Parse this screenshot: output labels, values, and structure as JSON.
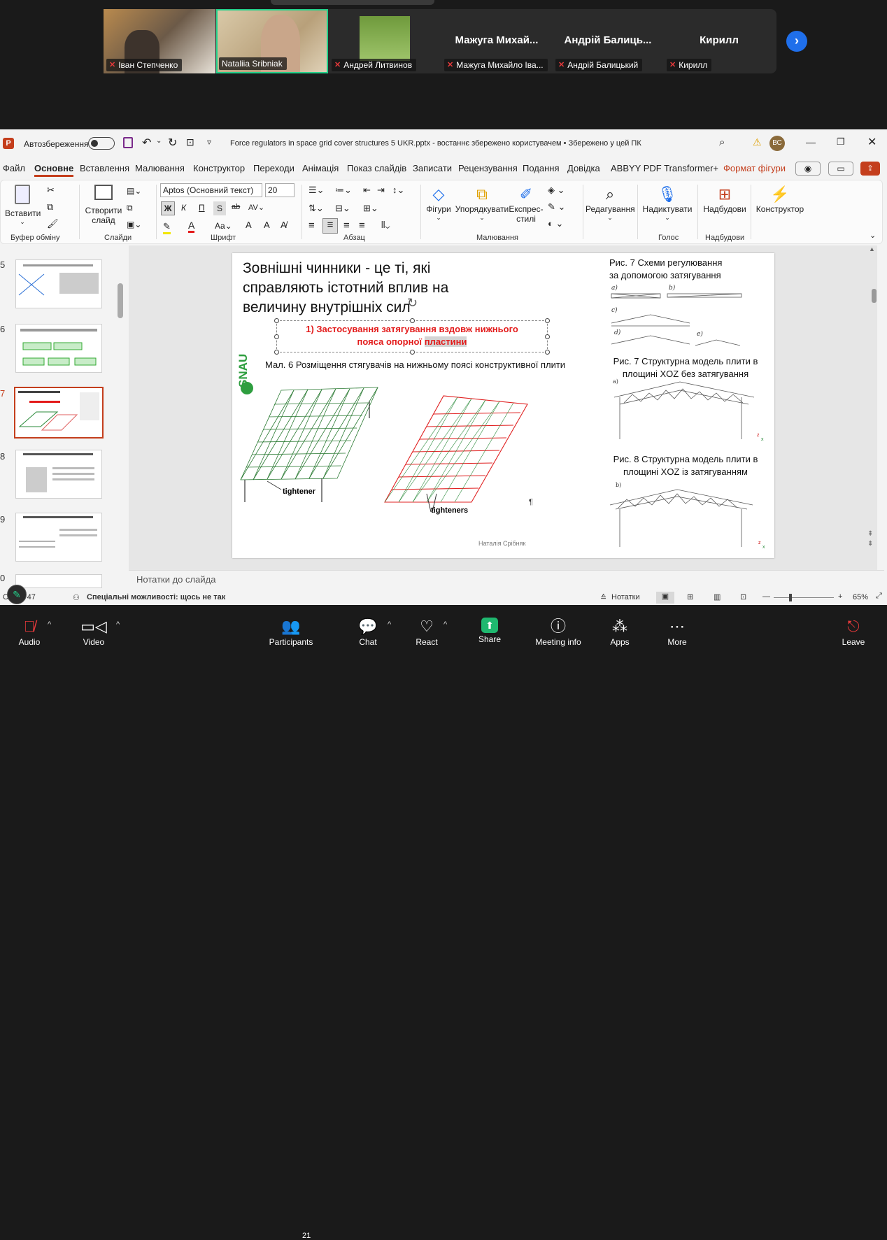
{
  "meeting": {
    "participants": [
      {
        "name": "Іван Степченко",
        "video": true
      },
      {
        "name": "Nataliia Sribniak",
        "video": true
      },
      {
        "name": "Андрей Литвинов",
        "video": true
      },
      {
        "name": "Мажуга Михайло Іва...",
        "display": "Мажуга  Михай..."
      },
      {
        "name": "Андрій Балицький",
        "display": "Андрій  Балиць..."
      },
      {
        "name": "Кирилл",
        "display": "Кирилл"
      }
    ],
    "toolbar": {
      "audio": "Audio",
      "video": "Video",
      "participants": "Participants",
      "participants_count": "21",
      "chat": "Chat",
      "react": "React",
      "share": "Share",
      "meeting_info": "Meeting info",
      "apps": "Apps",
      "more": "More",
      "leave": "Leave"
    },
    "colors": {
      "accent": "#1f6feb",
      "share": "#1fb86f",
      "leave": "#e5393b",
      "active_speaker_border": "#23d18b"
    }
  },
  "ppt": {
    "autosave_label": "Автозбереження",
    "file_title": "Force regulators in space grid cover structures 5 UKR.pptx  -  востаннє збережено користувачем •  Збережено у цей ПК",
    "user_initials": "ВС",
    "tabs": [
      "Файл",
      "Основне",
      "Вставлення",
      "Малювання",
      "Конструктор",
      "Переходи",
      "Анімація",
      "Показ слайдів",
      "Записати",
      "Рецензування",
      "Подання",
      "Довідка",
      "ABBYY PDF Transformer+",
      "Формат фігури"
    ],
    "active_tab": "Основне",
    "ribbon": {
      "paste": "Вставити",
      "new_slide": "Створити слайд",
      "font_name": "Aptos (Основний текст)",
      "font_size": "20",
      "bold": "Ж",
      "italic": "К",
      "underline": "П",
      "strike": "S",
      "shapes": "Фігури",
      "arrange": "Упорядкувати",
      "express_styles": "Експрес-стилі",
      "editing": "Редагування",
      "dictate": "Надиктувати",
      "addins": "Надбудови",
      "designer": "Конструктор",
      "groups": [
        "Буфер обміну",
        "Слайди",
        "Шрифт",
        "Абзац",
        "Малювання",
        "Голос",
        "Надбудови"
      ]
    },
    "thumbnails": [
      "5",
      "6",
      "7",
      "8",
      "9",
      "0"
    ],
    "active_thumbnail": "7",
    "slide": {
      "title": "Зовнішні чинники - це ті, які справляють істотний вплив на величину внутрішніх сил",
      "red_line1": "1) Застосування затягування вздовж нижнього",
      "red_line2_a": "пояса опорної ",
      "red_line2_b": "пластини",
      "caption_6": "Мал. 6 Розміщення стягувачів на нижньому поясі конструктивної плити",
      "fig7_title_1": "Рис. 7  Схеми регулювання",
      "fig7_title_2": "за допомогою затягування",
      "fig7_model_1": "Рис. 7 Структурна модель плити в",
      "fig7_model_2": "площині XOZ без затягування",
      "fig8_1": "Рис. 8 Структурна модель плити в",
      "fig8_2": "площині XOZ із затягуванням",
      "logo": "SNAU",
      "label_tightener": "tightener",
      "label_tighteners": "tighteners",
      "author": "Наталія Срібняк",
      "sub_a": "a)",
      "sub_b": "b)",
      "sub_c": "c)",
      "sub_d": "d)",
      "sub_e": "e)",
      "axis_z": "z",
      "axis_x": "x"
    },
    "notes_placeholder": "Нотатки до слайда",
    "status": {
      "slide_counter": "Сл... з 47",
      "accessibility": "Спеціальні можливості: щось не так",
      "notes_btn": "Нотатки",
      "zoom": "65%"
    },
    "colors": {
      "brand": "#c43e1c",
      "red_text": "#e31b1b",
      "logo_green": "#2e9e3f"
    }
  }
}
